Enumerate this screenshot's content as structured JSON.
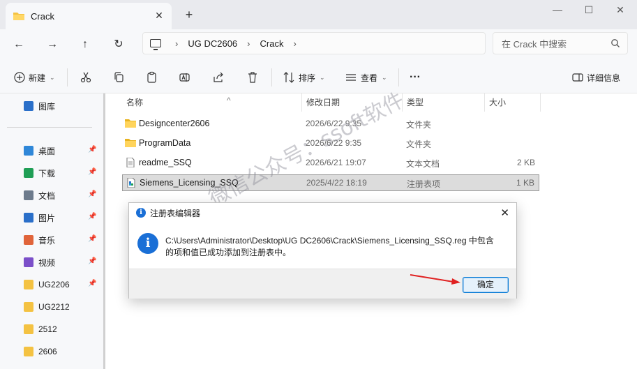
{
  "tab": {
    "title": "Crack",
    "close": "✕",
    "new_tab": "+"
  },
  "window_controls": {
    "minimize": "—",
    "maximize": "☐",
    "close": "✕"
  },
  "nav": {
    "back": "←",
    "forward": "→",
    "up": "↑",
    "refresh": "↻"
  },
  "address": {
    "crumbs": [
      "UG DC2606",
      "Crack"
    ],
    "separator": "›"
  },
  "search": {
    "placeholder": "在 Crack 中搜索"
  },
  "toolbar": {
    "new_label": "新建",
    "sort_label": "排序",
    "view_label": "查看",
    "more_label": "···",
    "details_label": "详细信息"
  },
  "sidebar": {
    "items": [
      {
        "label": "图库",
        "icon": "gallery-icon",
        "color": "#2a6fc9",
        "pinned": false
      },
      {
        "label": "桌面",
        "icon": "desktop-icon",
        "color": "#2f87d8",
        "pinned": true
      },
      {
        "label": "下载",
        "icon": "download-icon",
        "color": "#1f9e55",
        "pinned": true
      },
      {
        "label": "文档",
        "icon": "document-icon",
        "color": "#6d7b8c",
        "pinned": true
      },
      {
        "label": "图片",
        "icon": "pictures-icon",
        "color": "#2a6fc9",
        "pinned": true
      },
      {
        "label": "音乐",
        "icon": "music-icon",
        "color": "#e0643a",
        "pinned": true
      },
      {
        "label": "视频",
        "icon": "video-icon",
        "color": "#7b4fc9",
        "pinned": true
      },
      {
        "label": "UG2206",
        "icon": "folder-icon",
        "color": "#f4c242",
        "pinned": true
      },
      {
        "label": "UG2212",
        "icon": "folder-icon",
        "color": "#f4c242",
        "pinned": false
      },
      {
        "label": "2512",
        "icon": "folder-icon",
        "color": "#f4c242",
        "pinned": false
      },
      {
        "label": "2606",
        "icon": "folder-icon",
        "color": "#f4c242",
        "pinned": false
      }
    ],
    "pin_glyph": "📌"
  },
  "columns": {
    "name": "名称",
    "date": "修改日期",
    "type": "类型",
    "size": "大小",
    "sort_indicator": "^"
  },
  "files": [
    {
      "name": "Designcenter2606",
      "date": "2026/6/22 9:35",
      "type": "文件夹",
      "size": "",
      "icon": "folder-icon"
    },
    {
      "name": "ProgramData",
      "date": "2026/6/22 9:35",
      "type": "文件夹",
      "size": "",
      "icon": "folder-icon"
    },
    {
      "name": "readme_SSQ",
      "date": "2026/6/21 19:07",
      "type": "文本文档",
      "size": "2 KB",
      "icon": "text-file-icon"
    },
    {
      "name": "Siemens_Licensing_SSQ",
      "date": "2025/4/22 18:19",
      "type": "注册表项",
      "size": "1 KB",
      "icon": "registry-file-icon"
    }
  ],
  "dialog": {
    "title": "注册表编辑器",
    "message": "C:\\Users\\Administrator\\Desktop\\UG DC2606\\Crack\\Siemens_Licensing_SSQ.reg 中包含的项和值已成功添加到注册表中。",
    "ok_label": "确定",
    "close": "✕",
    "info_glyph": "i"
  },
  "watermark": "微信公众号：ssoft软件",
  "colors": {
    "accent": "#0078d4",
    "info_blue": "#1a6fd6",
    "arrow_red": "#e02020",
    "folder_yellow": "#f4c242"
  }
}
